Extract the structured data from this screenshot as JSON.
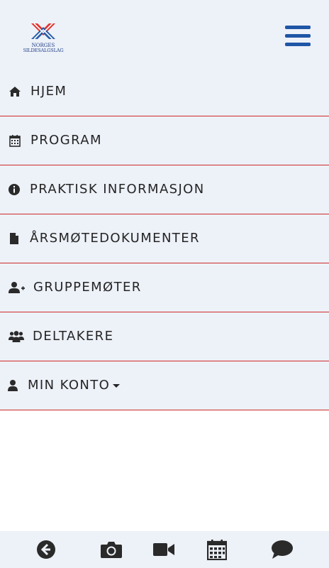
{
  "logo": {
    "line1": "NORGES",
    "line2": "SILDESALGSLAG"
  },
  "menu": {
    "items": [
      {
        "label": "HJEM",
        "icon": "home-icon"
      },
      {
        "label": "PROGRAM",
        "icon": "calendar-icon"
      },
      {
        "label": "PRAKTISK INFORMASJON",
        "icon": "info-icon"
      },
      {
        "label": "ÅRSMØTEDOKUMENTER",
        "icon": "document-icon"
      },
      {
        "label": "GRUPPEMØTER",
        "icon": "user-plus-icon"
      },
      {
        "label": "DELTAKERE",
        "icon": "users-icon"
      },
      {
        "label": "MIN KONTO",
        "icon": "user-icon"
      }
    ]
  },
  "bottom_bar": {
    "icons": [
      "back-icon",
      "camera-icon",
      "video-icon",
      "calendar-icon",
      "chat-icon"
    ]
  },
  "colors": {
    "brand_red": "#e3342f",
    "brand_blue": "#1f56a6",
    "separator": "#cf2a2a",
    "menu_bg": "#edf1f8",
    "icon": "#2a2a2a"
  }
}
